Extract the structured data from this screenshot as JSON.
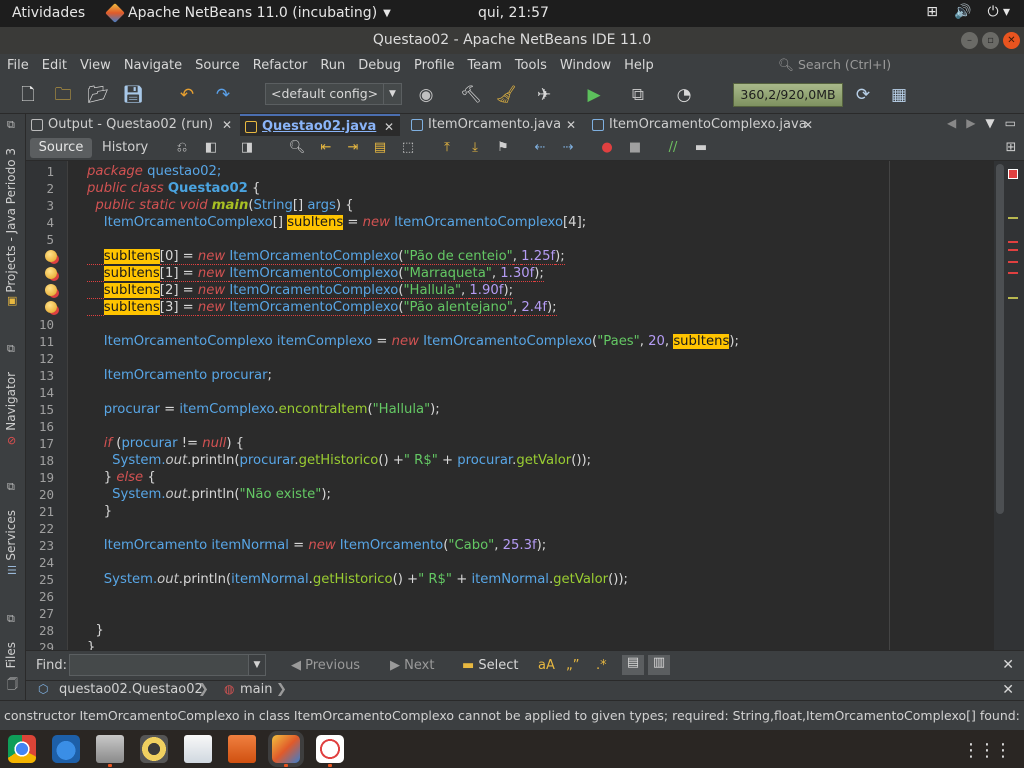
{
  "topbar": {
    "activities": "Atividades",
    "app": "Apache NetBeans 11.0 (incubating)",
    "clock": "qui, 21:57"
  },
  "window": {
    "title": "Questao02 - Apache NetBeans IDE 11.0"
  },
  "menu": {
    "items": [
      "File",
      "Edit",
      "View",
      "Navigate",
      "Source",
      "Refactor",
      "Run",
      "Debug",
      "Profile",
      "Team",
      "Tools",
      "Window",
      "Help"
    ],
    "search_placeholder": "Search (Ctrl+I)"
  },
  "toolbar": {
    "config": "<default config>",
    "memory": "360,2/920,0MB"
  },
  "sidebar": {
    "projects": "Projects - Java Periodo 3",
    "navigator": "Navigator",
    "services": "Services",
    "files": "Files"
  },
  "tabs": [
    {
      "label": "Output - Questao02 (run)",
      "active": false
    },
    {
      "label": "Questao02.java",
      "active": true
    },
    {
      "label": "ItemOrcamento.java",
      "active": false
    },
    {
      "label": "ItemOrcamentoComplexo.java",
      "active": false
    }
  ],
  "editor_toolbar": {
    "source": "Source",
    "history": "History"
  },
  "editor": {
    "line_numbers": [
      "1",
      "2",
      "3",
      "4",
      "5",
      "6",
      "7",
      "8",
      "9",
      "10",
      "11",
      "12",
      "13",
      "14",
      "15",
      "16",
      "17",
      "18",
      "19",
      "20",
      "21",
      "22",
      "23",
      "24",
      "25",
      "26",
      "27",
      "28",
      "29"
    ],
    "lines": [
      [
        {
          "t": "package ",
          "c": "kw"
        },
        {
          "t": "questao02;",
          "c": "ty"
        }
      ],
      [
        {
          "t": "public ",
          "c": "kw"
        },
        {
          "t": "class ",
          "c": "kw"
        },
        {
          "t": "Questao02",
          "c": "cl"
        },
        {
          "t": " {",
          "c": "pl"
        }
      ],
      [
        {
          "t": "  public ",
          "c": "kw"
        },
        {
          "t": "static ",
          "c": "kw"
        },
        {
          "t": "void ",
          "c": "kw"
        },
        {
          "t": "main",
          "c": "mt"
        },
        {
          "t": "(",
          "c": "pl"
        },
        {
          "t": "String",
          "c": "ty"
        },
        {
          "t": "[] ",
          "c": "pl"
        },
        {
          "t": "args",
          "c": "ty"
        },
        {
          "t": ") {",
          "c": "pl"
        }
      ],
      [
        {
          "t": "    ItemOrcamentoComplexo",
          "c": "ty"
        },
        {
          "t": "[] ",
          "c": "pl"
        },
        {
          "t": "subItens",
          "c": "hl"
        },
        {
          "t": " = ",
          "c": "pl"
        },
        {
          "t": "new ",
          "c": "kw"
        },
        {
          "t": "ItemOrcamentoComplexo",
          "c": "ty"
        },
        {
          "t": "[4];",
          "c": "pl"
        }
      ],
      [],
      [
        {
          "t": "    ",
          "c": "pl"
        },
        {
          "t": "subItens",
          "c": "hl"
        },
        {
          "t": "[0] = ",
          "c": "pl"
        },
        {
          "t": "new ",
          "c": "kw"
        },
        {
          "t": "ItemOrcamentoComplexo",
          "c": "ty"
        },
        {
          "t": "(",
          "c": "pl"
        },
        {
          "t": "\"Pão de centeio\"",
          "c": "st"
        },
        {
          "t": ", ",
          "c": "pl"
        },
        {
          "t": "1.25f",
          "c": "nu"
        },
        {
          "t": ");",
          "c": "pl"
        }
      ],
      [
        {
          "t": "    ",
          "c": "pl"
        },
        {
          "t": "subItens",
          "c": "hl"
        },
        {
          "t": "[1] = ",
          "c": "pl"
        },
        {
          "t": "new ",
          "c": "kw"
        },
        {
          "t": "ItemOrcamentoComplexo",
          "c": "ty"
        },
        {
          "t": "(",
          "c": "pl"
        },
        {
          "t": "\"Marraqueta\"",
          "c": "st"
        },
        {
          "t": ", ",
          "c": "pl"
        },
        {
          "t": "1.30f",
          "c": "nu"
        },
        {
          "t": ");",
          "c": "pl"
        }
      ],
      [
        {
          "t": "    ",
          "c": "pl"
        },
        {
          "t": "subItens",
          "c": "hl"
        },
        {
          "t": "[2] = ",
          "c": "pl"
        },
        {
          "t": "new ",
          "c": "kw"
        },
        {
          "t": "ItemOrcamentoComplexo",
          "c": "ty"
        },
        {
          "t": "(",
          "c": "pl"
        },
        {
          "t": "\"Hallula\"",
          "c": "st"
        },
        {
          "t": ", ",
          "c": "pl"
        },
        {
          "t": "1.90f",
          "c": "nu"
        },
        {
          "t": ");",
          "c": "pl"
        }
      ],
      [
        {
          "t": "    ",
          "c": "pl"
        },
        {
          "t": "subItens",
          "c": "hl"
        },
        {
          "t": "[3] = ",
          "c": "pl"
        },
        {
          "t": "new ",
          "c": "kw"
        },
        {
          "t": "ItemOrcamentoComplexo",
          "c": "ty"
        },
        {
          "t": "(",
          "c": "pl"
        },
        {
          "t": "\"Pão alentejano\"",
          "c": "st"
        },
        {
          "t": ", ",
          "c": "pl"
        },
        {
          "t": "2.4f",
          "c": "nu"
        },
        {
          "t": ");",
          "c": "pl"
        }
      ],
      [],
      [
        {
          "t": "    ItemOrcamentoComplexo ",
          "c": "ty"
        },
        {
          "t": "itemComplexo",
          "c": "ty"
        },
        {
          "t": " = ",
          "c": "pl"
        },
        {
          "t": "new ",
          "c": "kw"
        },
        {
          "t": "ItemOrcamentoComplexo",
          "c": "ty"
        },
        {
          "t": "(",
          "c": "pl"
        },
        {
          "t": "\"Paes\"",
          "c": "st"
        },
        {
          "t": ", ",
          "c": "pl"
        },
        {
          "t": "20",
          "c": "nu"
        },
        {
          "t": ", ",
          "c": "pl"
        },
        {
          "t": "subItens",
          "c": "hl"
        },
        {
          "t": ");",
          "c": "pl"
        }
      ],
      [],
      [
        {
          "t": "    ItemOrcamento ",
          "c": "ty"
        },
        {
          "t": "procurar",
          "c": "ty"
        },
        {
          "t": ";",
          "c": "pl"
        }
      ],
      [],
      [
        {
          "t": "    procurar",
          "c": "ty"
        },
        {
          "t": " = ",
          "c": "pl"
        },
        {
          "t": "itemComplexo",
          "c": "ty"
        },
        {
          "t": ".",
          "c": "pl"
        },
        {
          "t": "encontraItem",
          "c": "fn"
        },
        {
          "t": "(",
          "c": "pl"
        },
        {
          "t": "\"Hallula\"",
          "c": "st"
        },
        {
          "t": ");",
          "c": "pl"
        }
      ],
      [],
      [
        {
          "t": "    if ",
          "c": "kw"
        },
        {
          "t": "(",
          "c": "pl"
        },
        {
          "t": "procurar",
          "c": "ty"
        },
        {
          "t": " != ",
          "c": "pl"
        },
        {
          "t": "null",
          "c": "kw"
        },
        {
          "t": ") {",
          "c": "pl"
        }
      ],
      [
        {
          "t": "      System.",
          "c": "ty"
        },
        {
          "t": "out",
          "c": "it"
        },
        {
          "t": ".println(",
          "c": "pl"
        },
        {
          "t": "procurar",
          "c": "ty"
        },
        {
          "t": ".",
          "c": "pl"
        },
        {
          "t": "getHistorico",
          "c": "fn"
        },
        {
          "t": "() +",
          "c": "pl"
        },
        {
          "t": "\" R$\"",
          "c": "st"
        },
        {
          "t": " + ",
          "c": "pl"
        },
        {
          "t": "procurar",
          "c": "ty"
        },
        {
          "t": ".",
          "c": "pl"
        },
        {
          "t": "getValor",
          "c": "fn"
        },
        {
          "t": "());",
          "c": "pl"
        }
      ],
      [
        {
          "t": "    } ",
          "c": "pl"
        },
        {
          "t": "else ",
          "c": "kw"
        },
        {
          "t": "{",
          "c": "pl"
        }
      ],
      [
        {
          "t": "      System.",
          "c": "ty"
        },
        {
          "t": "out",
          "c": "it"
        },
        {
          "t": ".println(",
          "c": "pl"
        },
        {
          "t": "\"Não existe\"",
          "c": "st"
        },
        {
          "t": ");",
          "c": "pl"
        }
      ],
      [
        {
          "t": "    }",
          "c": "pl"
        }
      ],
      [],
      [
        {
          "t": "    ItemOrcamento ",
          "c": "ty"
        },
        {
          "t": "itemNormal",
          "c": "ty"
        },
        {
          "t": " = ",
          "c": "pl"
        },
        {
          "t": "new ",
          "c": "kw"
        },
        {
          "t": "ItemOrcamento",
          "c": "ty"
        },
        {
          "t": "(",
          "c": "pl"
        },
        {
          "t": "\"Cabo\"",
          "c": "st"
        },
        {
          "t": ", ",
          "c": "pl"
        },
        {
          "t": "25.3f",
          "c": "nu"
        },
        {
          "t": ");",
          "c": "pl"
        }
      ],
      [],
      [
        {
          "t": "    System.",
          "c": "ty"
        },
        {
          "t": "out",
          "c": "it"
        },
        {
          "t": ".println(",
          "c": "pl"
        },
        {
          "t": "itemNormal",
          "c": "ty"
        },
        {
          "t": ".",
          "c": "pl"
        },
        {
          "t": "getHistorico",
          "c": "fn"
        },
        {
          "t": "() +",
          "c": "pl"
        },
        {
          "t": "\" R$\"",
          "c": "st"
        },
        {
          "t": " + ",
          "c": "pl"
        },
        {
          "t": "itemNormal",
          "c": "ty"
        },
        {
          "t": ".",
          "c": "pl"
        },
        {
          "t": "getValor",
          "c": "fn"
        },
        {
          "t": "());",
          "c": "pl"
        }
      ],
      [],
      [],
      [
        {
          "t": "  }",
          "c": "pl"
        }
      ],
      [
        {
          "t": "}",
          "c": "pl"
        }
      ]
    ],
    "error_lines": [
      6,
      7,
      8,
      9
    ]
  },
  "find": {
    "label": "Find:",
    "previous": "Previous",
    "next": "Next",
    "select": "Select"
  },
  "breadcrumb": {
    "class": "questao02.Questao02",
    "method": "main"
  },
  "status": "constructor ItemOrcamentoComplexo in class ItemOrcamentoComplexo cannot be applied to given types;   required: String,float,ItemOrcamentoComplexo[]   found: Str",
  "colors": {
    "accent": "#4b6eaf",
    "highlight": "#ffc400",
    "error": "#e04040"
  }
}
